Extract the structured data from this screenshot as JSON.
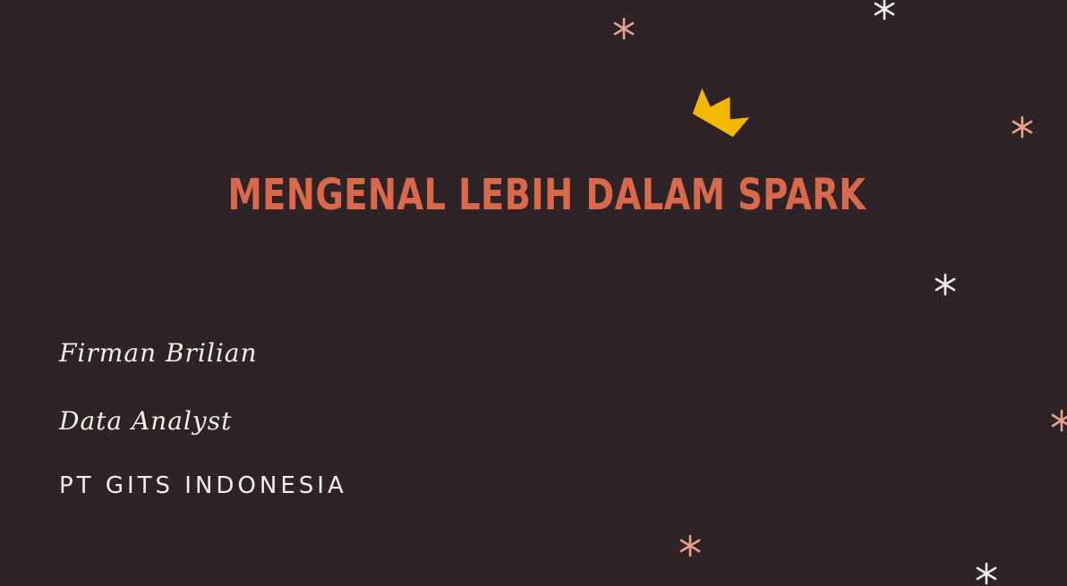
{
  "slide": {
    "title": "MENGENAL LEBIH DALAM SPARK",
    "presenter_name": "Firman Brilian",
    "presenter_role": "Data Analyst",
    "company": "PT GITS INDONESIA"
  },
  "colors": {
    "background": "#2e2326",
    "title": "#d9694a",
    "text": "#f4efe9",
    "crown": "#f5b800",
    "star_white": "#f4efe9",
    "star_peach": "#eda08f"
  },
  "decorations": {
    "crown_icon": "crown-icon",
    "star_icon": "asterisk-star-icon"
  }
}
